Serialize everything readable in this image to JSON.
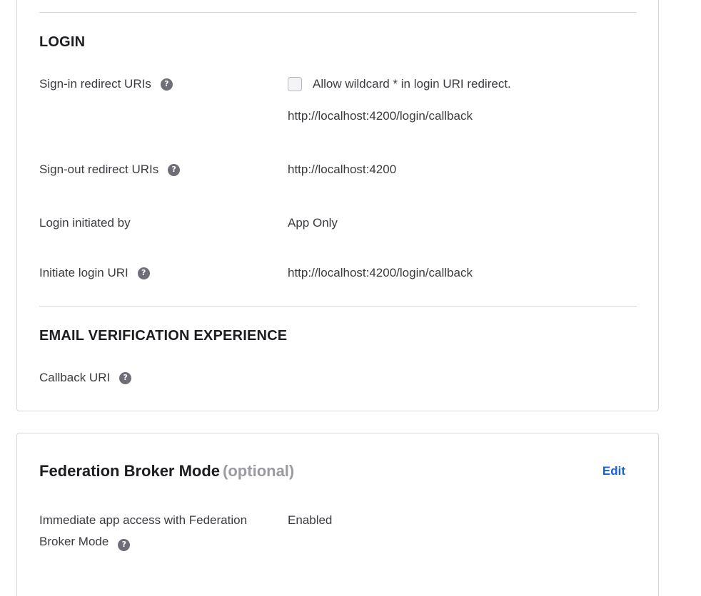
{
  "login_card": {
    "section_title": "LOGIN",
    "sign_in": {
      "label": "Sign-in redirect URIs",
      "wildcard_label": "Allow wildcard * in login URI redirect.",
      "value": "http://localhost:4200/login/callback"
    },
    "sign_out": {
      "label": "Sign-out redirect URIs",
      "value": "http://localhost:4200"
    },
    "initiated_by": {
      "label": "Login initiated by",
      "value": "App Only"
    },
    "initiate_uri": {
      "label": "Initiate login URI",
      "value": "http://localhost:4200/login/callback"
    },
    "email_section_title": "EMAIL VERIFICATION EXPERIENCE",
    "callback": {
      "label": "Callback URI"
    },
    "help_glyph": "?"
  },
  "federation_card": {
    "title": "Federation Broker Mode",
    "optional": "(optional)",
    "edit_label": "Edit",
    "immediate_access": {
      "label_line1": "Immediate app access with Federation",
      "label_line2": "Broker Mode",
      "value": "Enabled"
    }
  },
  "colors": {
    "link": "#1662dd",
    "help_icon": "#6e6e78",
    "border": "#d7d7dc"
  }
}
